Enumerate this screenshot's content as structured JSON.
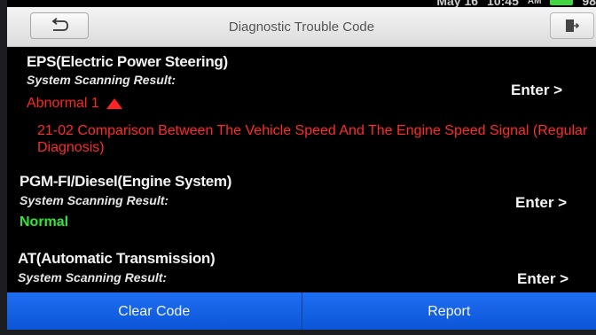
{
  "header": {
    "title": "Diagnostic Trouble Code",
    "back_icon": "back-arrow-icon",
    "exit_icon": "exit-icon"
  },
  "status_bar": {
    "date": "May 16",
    "time": "10:45",
    "ampm": "AM",
    "battery": "98",
    "battery_color": "#43d343"
  },
  "systems": [
    {
      "name": "EPS(Electric Power Steering)",
      "scan_label": "System Scanning Result:",
      "status": "Abnormal 1",
      "status_color": "#ff2323",
      "enter_label": "Enter >",
      "dtc_lines": [
        "21-02 Comparison Between The Vehicle Speed And The Engine Speed Signal (Regular",
        "Diagnosis)"
      ]
    },
    {
      "name": "PGM-FI/Diesel(Engine System)",
      "scan_label": "System Scanning Result:",
      "status": "Normal",
      "status_color": "#37e23a",
      "enter_label": "Enter >"
    },
    {
      "name": "AT(Automatic Transmission)",
      "scan_label": "System Scanning Result:",
      "enter_label": "Enter >"
    }
  ],
  "bottom_bar": {
    "clear_code": "Clear Code",
    "report": "Report",
    "button_color": "#1565e6"
  }
}
